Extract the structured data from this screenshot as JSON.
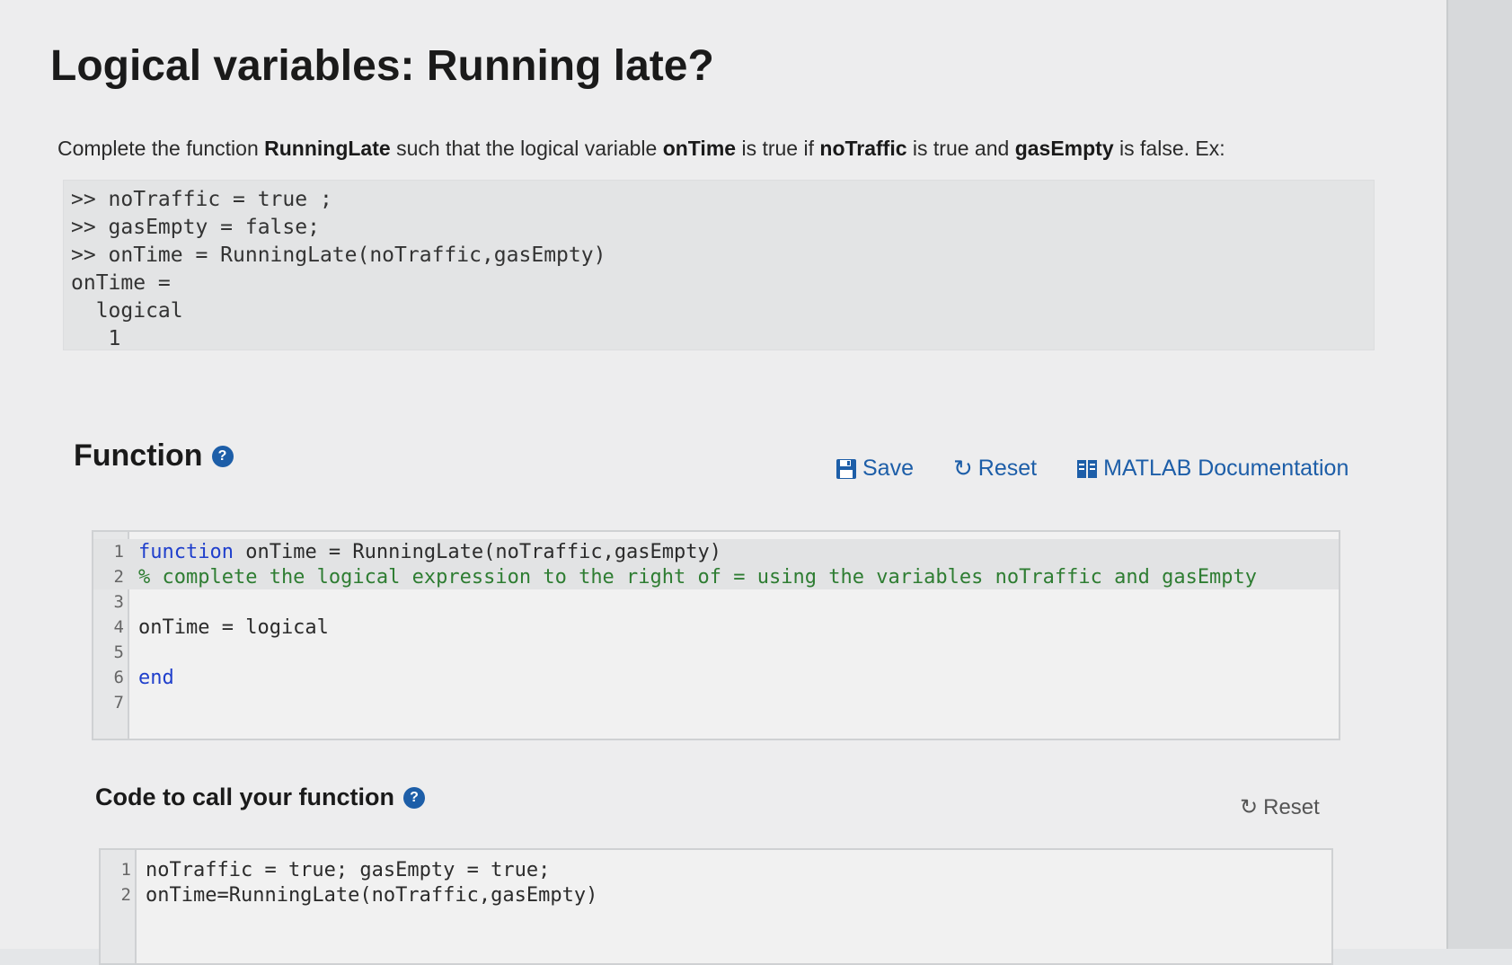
{
  "title": "Logical variables: Running late?",
  "description": {
    "p1": "Complete the function ",
    "b1": "RunningLate",
    "p2": " such that the logical variable ",
    "b2": "onTime",
    "p3": " is true if ",
    "b3": "noTraffic",
    "p4": " is true and ",
    "b4": "gasEmpty",
    "p5": " is false.  Ex:"
  },
  "example_lines": [
    ">> noTraffic = true ;",
    ">> gasEmpty = false;",
    ">> onTime = RunningLate(noTraffic,gasEmpty)",
    "onTime =",
    "  logical",
    "   1"
  ],
  "function_section": {
    "title": "Function",
    "help_icon": "question-circle-icon",
    "toolbar": {
      "save_label": "Save",
      "reset_label": "Reset",
      "docs_label": "MATLAB Documentation"
    },
    "lines": [
      {
        "num": "1",
        "keyword": "function",
        "text": " onTime = RunningLate(noTraffic,gasEmpty)"
      },
      {
        "num": "2",
        "comment": "% complete the logical expression to the right of = using the variables noTraffic and gasEmpty"
      },
      {
        "num": "3",
        "text": ""
      },
      {
        "num": "4",
        "text": "onTime = logical"
      },
      {
        "num": "5",
        "text": ""
      },
      {
        "num": "6",
        "keyword": "end",
        "text": ""
      },
      {
        "num": "7",
        "text": ""
      }
    ]
  },
  "call_section": {
    "title": "Code to call your function",
    "reset_label": "Reset",
    "lines": [
      {
        "num": "1",
        "text": "noTraffic = true; gasEmpty = true;"
      },
      {
        "num": "2",
        "text": "onTime=RunningLate(noTraffic,gasEmpty)"
      }
    ]
  },
  "colors": {
    "link": "#1d5ea8",
    "keyword": "#1f3fcc",
    "comment": "#2e7d32"
  }
}
